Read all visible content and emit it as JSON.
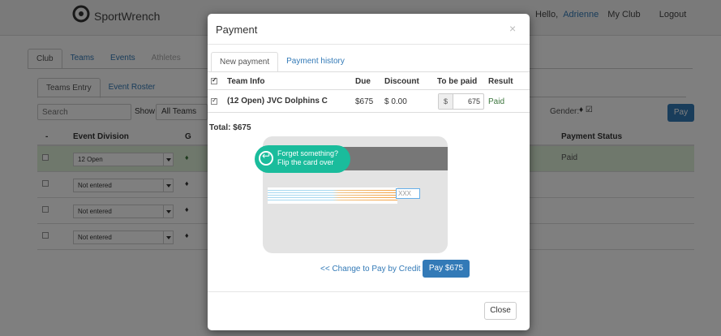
{
  "app": {
    "brand": "SportWrench",
    "greeting": "Hello,",
    "user": "Adrienne",
    "my_club": "My Club",
    "logout": "Logout"
  },
  "main_tabs": [
    {
      "label": "Club"
    },
    {
      "label": "Teams"
    },
    {
      "label": "Events"
    },
    {
      "label": "Athletes"
    }
  ],
  "sub_tabs": [
    {
      "label": "Teams Entry"
    },
    {
      "label": "Event Roster"
    }
  ],
  "filters": {
    "search_placeholder": "Search",
    "show_label": "Show",
    "show_value": "All Teams",
    "gender_label": "Gender:",
    "pay_button": "Pay"
  },
  "bg_table": {
    "headers": {
      "col0": "-",
      "division": "Event Division",
      "g": "G",
      "status": "Payment Status"
    },
    "rows": [
      {
        "division": "12 Open",
        "status": "Paid"
      },
      {
        "division": "Not entered",
        "status": ""
      },
      {
        "division": "Not entered",
        "status": ""
      },
      {
        "division": "Not entered",
        "status": ""
      }
    ]
  },
  "modal": {
    "title": "Payment",
    "close_symbol": "×",
    "tabs": [
      {
        "label": "New payment"
      },
      {
        "label": "Payment history"
      }
    ],
    "table": {
      "headers": {
        "team": "Team Info",
        "due": "Due",
        "discount": "Discount",
        "to_be_paid": "To be paid",
        "result": "Result"
      },
      "rows": [
        {
          "team": "(12 Open) JVC Dolphins C",
          "due": "$675",
          "discount": "$ 0.00",
          "currency": "$",
          "amount": "675",
          "result": "Paid"
        }
      ]
    },
    "total": "Total: $675",
    "card": {
      "tooltip_line1": "Forget something?",
      "tooltip_line2": "Flip the card over",
      "cvv_placeholder": "XXX"
    },
    "change_link": "<< Change to Pay by Credit",
    "pay_button": "Pay $675",
    "close_button": "Close"
  },
  "colors": {
    "primary": "#337ab7",
    "tooltip_teal": "#1abc9c",
    "paid_green": "#3c763d",
    "row_success": "#dff0d8"
  },
  "icons": {
    "brand": "sportwrench-logo-icon",
    "sort": "sort-icon",
    "tooltip": "flip-arrow-icon"
  }
}
